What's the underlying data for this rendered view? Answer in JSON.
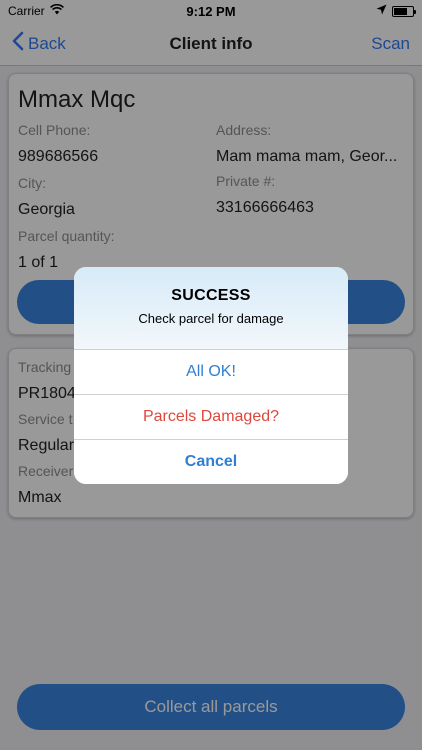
{
  "status_bar": {
    "carrier": "Carrier",
    "time": "9:12 PM"
  },
  "nav": {
    "back_label": "Back",
    "title": "Client info",
    "scan_label": "Scan"
  },
  "client": {
    "name": "Mmax Mqc",
    "cell_phone_label": "Cell Phone:",
    "cell_phone": "989686566",
    "address_label": "Address:",
    "address": "Mam mama mam, Geor...",
    "city_label": "City:",
    "city": "Georgia",
    "private_label": "Private #:",
    "private_number": "33166666463",
    "parcel_quantity_label": "Parcel quantity:",
    "parcel_quantity": "1 of 1"
  },
  "parcel": {
    "tracking_label": "Tracking",
    "tracking": "PR1804",
    "service_label": "Service t",
    "service": "Regular",
    "receiver_label": "Receiver",
    "receiver": "Mmax"
  },
  "bottom_button": {
    "label": "Collect all parcels"
  },
  "alert": {
    "title": "SUCCESS",
    "message": "Check parcel for damage",
    "actions": {
      "ok": "All OK!",
      "damaged": "Parcels Damaged?",
      "cancel": "Cancel"
    }
  },
  "colors": {
    "accent": "#3478f6",
    "button": "#3a85e0",
    "danger": "#e0473c"
  },
  "icons": {
    "wifi": "wifi-icon",
    "location": "location-arrow-icon",
    "battery": "battery-icon",
    "back": "chevron-left-icon"
  }
}
